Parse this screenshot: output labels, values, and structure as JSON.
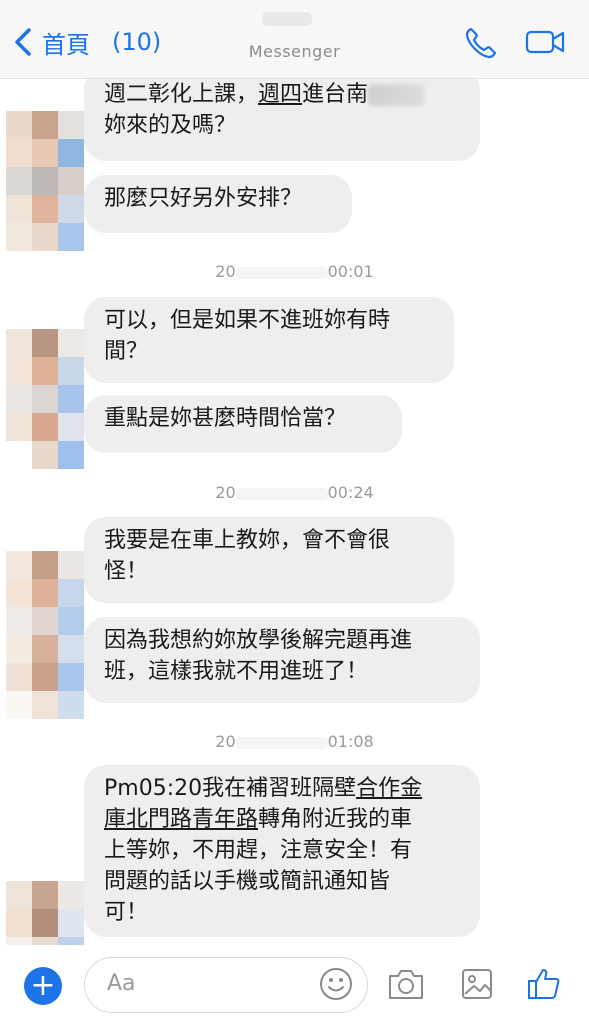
{
  "header": {
    "back_label": "首頁",
    "unread_count": "(10)",
    "title": "Messenger",
    "call_icon": "phone-icon",
    "video_icon": "video-camera-icon",
    "accent_color": "#1e74e6"
  },
  "messages": [
    {
      "line1_parts": [
        "週二彰化上課，",
        "週四",
        "進台南"
      ],
      "line2": "妳來的及嗎？"
    },
    {
      "text": "那麼只好另外安排？"
    },
    {
      "timestamp": "20… 00:01"
    },
    {
      "line1": "可以，但是如果不進班妳有時",
      "line2": "間？"
    },
    {
      "text": "重點是妳甚麼時間恰當？"
    },
    {
      "timestamp": "20… 00:24"
    },
    {
      "line1": "我要是在車上教妳，會不會很",
      "line2": "怪！"
    },
    {
      "line1": "因為我想約妳放學後解完題再進",
      "line2": "班，這樣我就不用進班了！"
    },
    {
      "timestamp": "20… 01:08"
    },
    {
      "line1_pre": "Pm05:20我在補習班隔壁",
      "line1_link": "合作金",
      "line2_link": "庫北門路青年路",
      "line2_post": "轉角附近我的車",
      "line3": "上等妳，不用趕，注意安全！有",
      "line4": "問題的話以手機或簡訊通知皆",
      "line5": "可！"
    }
  ],
  "timestamps": {
    "t1_start": "20",
    "t1_end": "00:01",
    "t2_start": "20",
    "t2_end": "00:24",
    "t3_start": "20",
    "t3_end": "01:08"
  },
  "composer": {
    "placeholder": "Aa",
    "icons": [
      "plus-icon",
      "emoji-icon",
      "camera-icon",
      "image-icon",
      "thumbs-up-icon"
    ]
  }
}
